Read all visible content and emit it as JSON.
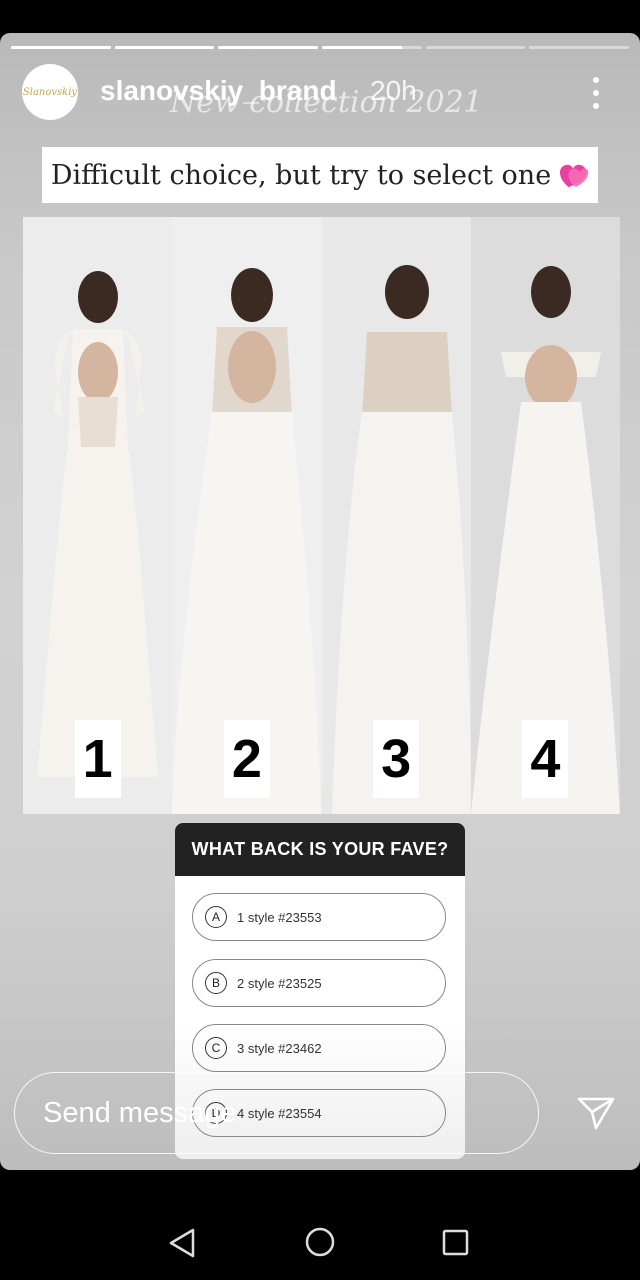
{
  "story": {
    "username": "slanovskiy_brand",
    "time": "20h",
    "watermark": "New collection 2021",
    "avatar_text": "Slanovskiy",
    "progress": [
      1,
      1,
      1,
      0.8,
      0,
      0
    ]
  },
  "caption": {
    "text": "Difficult choice, but try to select one"
  },
  "dresses": [
    {
      "number": "1"
    },
    {
      "number": "2"
    },
    {
      "number": "3"
    },
    {
      "number": "4"
    }
  ],
  "poll": {
    "question": "WHAT BACK IS YOUR FAVE?",
    "options": [
      {
        "letter": "A",
        "label": "1 style #23553"
      },
      {
        "letter": "B",
        "label": "2 style #23525"
      },
      {
        "letter": "C",
        "label": "3 style #23462"
      },
      {
        "letter": "D",
        "label": "4 style #23554"
      }
    ]
  },
  "message": {
    "placeholder": "Send message"
  },
  "icons": {
    "more": "more-vertical-icon",
    "send": "send-icon",
    "heart": "heart-icon",
    "nav_back": "back-triangle-icon",
    "nav_home": "home-circle-icon",
    "nav_recent": "recents-square-icon"
  },
  "colors": {
    "poll_header": "#222222",
    "background": "#000000",
    "heart": "#e8409c"
  }
}
